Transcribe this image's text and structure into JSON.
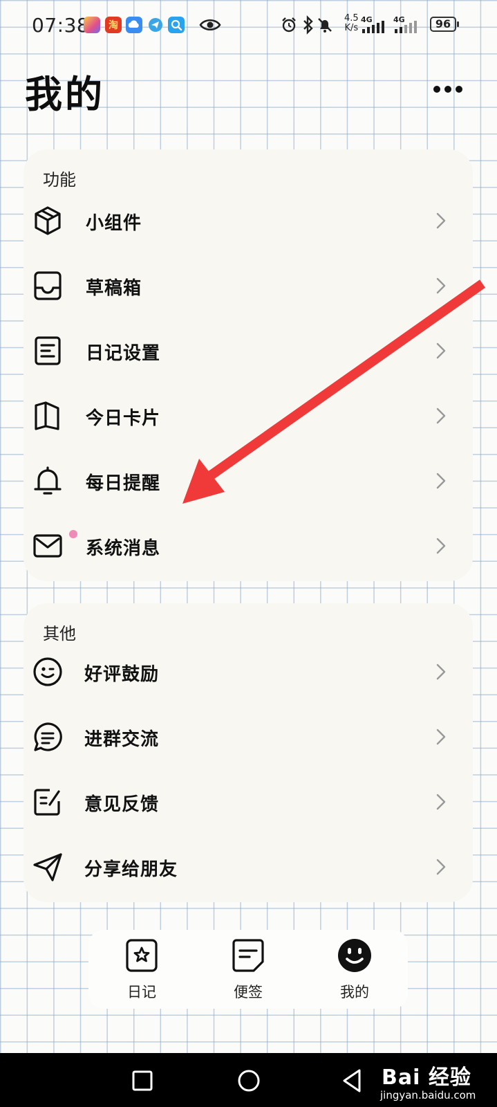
{
  "status_bar": {
    "time": "07:38",
    "net_speed_value": "4.5",
    "net_speed_unit": "K/s",
    "signal_1_label": "4G",
    "signal_2_label": "4G",
    "battery": "96"
  },
  "header": {
    "title": "我的"
  },
  "sections": [
    {
      "title": "功能",
      "items": [
        {
          "label": "小组件",
          "icon": "cube-icon"
        },
        {
          "label": "草稿箱",
          "icon": "inbox-tray-icon"
        },
        {
          "label": "日记设置",
          "icon": "document-lines-icon"
        },
        {
          "label": "今日卡片",
          "icon": "book-open-icon"
        },
        {
          "label": "每日提醒",
          "icon": "bell-icon"
        },
        {
          "label": "系统消息",
          "icon": "mail-icon",
          "has_badge": true
        }
      ]
    },
    {
      "title": "其他",
      "items": [
        {
          "label": "好评鼓励",
          "icon": "wink-face-icon"
        },
        {
          "label": "进群交流",
          "icon": "chat-bubble-icon"
        },
        {
          "label": "意见反馈",
          "icon": "edit-note-icon"
        },
        {
          "label": "分享给朋友",
          "icon": "send-plane-icon"
        }
      ]
    }
  ],
  "tabs": [
    {
      "label": "日记",
      "icon": "star-note-icon",
      "active": false
    },
    {
      "label": "便签",
      "icon": "memo-icon",
      "active": false
    },
    {
      "label": "我的",
      "icon": "smiley-face-icon",
      "active": true
    }
  ],
  "watermark": {
    "main": "Bai 经验",
    "sub": "jingyan.baidu.com"
  },
  "colors": {
    "accent_arrow": "#f03a3a",
    "badge": "#f08ab7",
    "card_bg": "#f8f7f2",
    "grid_line": "#8caac8"
  }
}
